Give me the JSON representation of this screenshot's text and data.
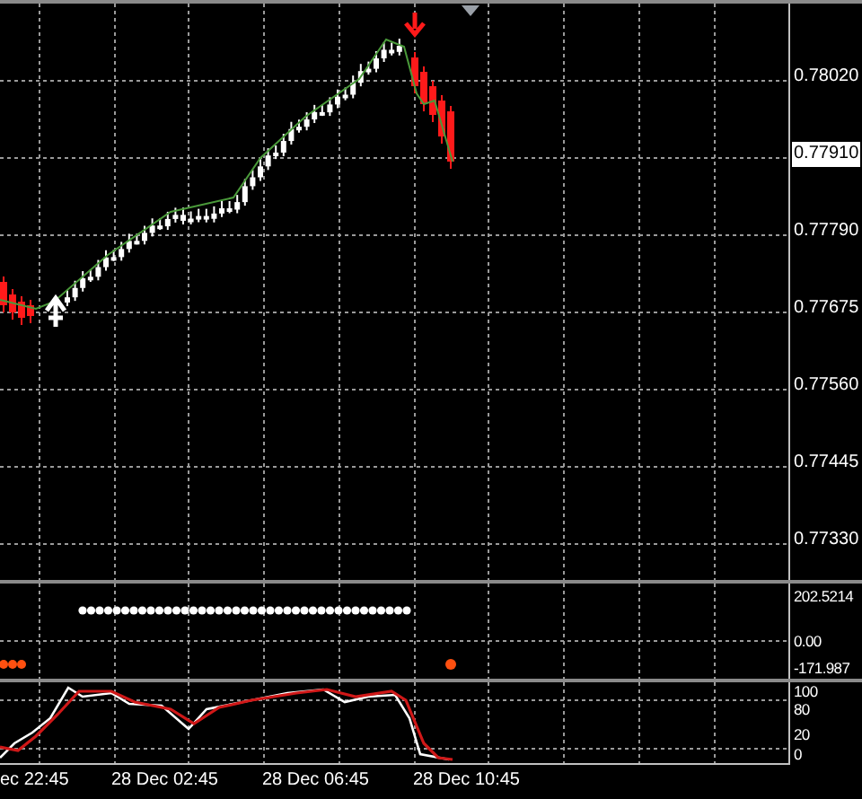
{
  "price_axis": [
    {
      "text": "0.78020",
      "highlighted": false
    },
    {
      "text": "0.77910",
      "highlighted": true
    },
    {
      "text": "0.77790",
      "highlighted": false
    },
    {
      "text": "0.77675",
      "highlighted": false
    },
    {
      "text": "0.77560",
      "highlighted": false
    },
    {
      "text": "0.77445",
      "highlighted": false
    },
    {
      "text": "0.77330",
      "highlighted": false
    }
  ],
  "indicator_axis": [
    "202.5214",
    "0.00",
    "-171.987"
  ],
  "oscillator_axis": [
    "100",
    "80",
    "20",
    "0"
  ],
  "time_axis": [
    "ec 22:45",
    "28 Dec 02:45",
    "28 Dec 06:45",
    "28 Dec 10:45"
  ]
}
